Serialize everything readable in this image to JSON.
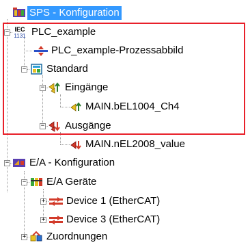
{
  "tree": {
    "sps": {
      "label": "SPS - Konfiguration",
      "selected": true
    },
    "plc": {
      "label": "PLC_example",
      "icon_text": "IEC 1131"
    },
    "prozessabbild": {
      "label": "PLC_example-Prozessabbild"
    },
    "standard": {
      "label": "Standard"
    },
    "eingaenge": {
      "label": "Eingänge"
    },
    "main_in": {
      "label": "MAIN.bEL1004_Ch4"
    },
    "ausgaenge": {
      "label": "Ausgänge"
    },
    "main_out": {
      "label": "MAIN.nEL2008_value"
    },
    "ea_konf": {
      "label": "E/A - Konfiguration"
    },
    "ea_geraete": {
      "label": "E/A Geräte"
    },
    "device1": {
      "label": "Device 1 (EtherCAT)"
    },
    "device3": {
      "label": "Device 3 (EtherCAT)"
    },
    "zuordnungen": {
      "label": "Zuordnungen"
    }
  },
  "colors": {
    "selection": "#3399ff",
    "highlight_border": "#e8202a"
  },
  "icons": [
    "sps-icon",
    "iec-icon",
    "prozessabbild-icon",
    "standard-icon",
    "input-icon",
    "output-icon",
    "ea-config-icon",
    "ea-devices-icon",
    "ethercat-device-icon",
    "mapping-icon"
  ]
}
